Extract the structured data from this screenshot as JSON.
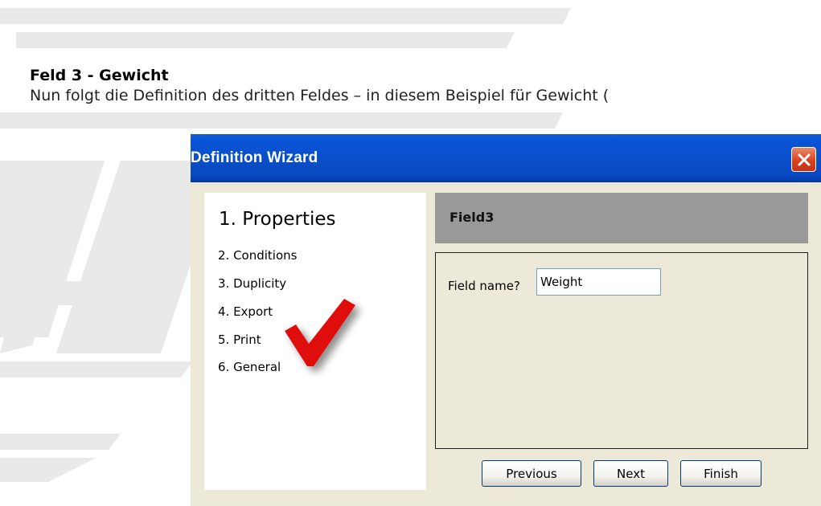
{
  "document": {
    "heading": "Feld 3 - Gewicht",
    "text": "Nun folgt die Definition des dritten Feldes – in diesem Beispiel für Gewicht ("
  },
  "wizard": {
    "title": "Definition Wizard",
    "close_icon": "close-icon",
    "steps": {
      "active": "1. Properties",
      "items": [
        "2. Conditions",
        "3. Duplicity",
        "4. Export",
        "5. Print",
        "6. General"
      ],
      "completed_icon": "checkmark-icon"
    },
    "header_title": "Field3",
    "field_label": "Field name?",
    "field_value": "Weight",
    "buttons": {
      "previous": "Previous",
      "next": "Next",
      "finish": "Finish"
    },
    "colors": {
      "titlebar": "#0a4fc9",
      "close_button": "#d9411e",
      "header_band": "#999999",
      "window_bg": "#ece9d8",
      "checkmark": "#e01010"
    }
  }
}
